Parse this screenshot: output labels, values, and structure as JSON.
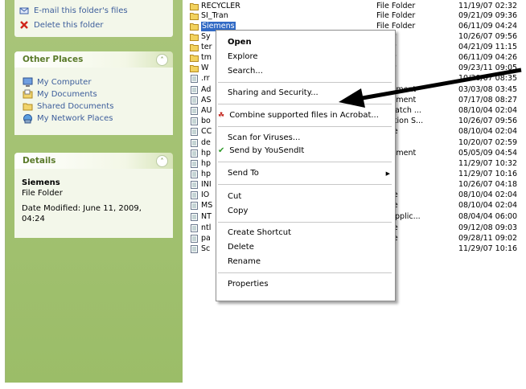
{
  "task_pane": {
    "file_tasks": [
      {
        "label": "E-mail this folder's files",
        "icon": "email-icon"
      },
      {
        "label": "Delete this folder",
        "icon": "delete-x-icon"
      }
    ],
    "other_places": {
      "title": "Other Places",
      "items": [
        {
          "label": "My Computer",
          "icon": "my-computer-icon"
        },
        {
          "label": "My Documents",
          "icon": "my-documents-icon"
        },
        {
          "label": "Shared Documents",
          "icon": "shared-documents-icon"
        },
        {
          "label": "My Network Places",
          "icon": "network-places-icon"
        }
      ]
    },
    "details": {
      "title": "Details",
      "name": "Siemens",
      "type": "File Folder",
      "date_modified": "Date Modified: June 11, 2009,",
      "time": "04:24"
    }
  },
  "files": [
    {
      "name": "RECYCLER",
      "type": "File Folder",
      "date": "11/19/07 02:32",
      "icon": "folder-icon"
    },
    {
      "name": "SI_Tran",
      "type": "File Folder",
      "date": "09/21/09 09:36",
      "icon": "folder-icon"
    },
    {
      "name": "Siemens",
      "type": "File Folder",
      "date": "06/11/09 04:24",
      "icon": "folder-icon",
      "selected": true
    },
    {
      "name": "Sy",
      "type": "older",
      "date": "10/26/07 09:56",
      "icon": "folder-icon"
    },
    {
      "name": "ter",
      "type": "older",
      "date": "04/21/09 11:15",
      "icon": "folder-icon"
    },
    {
      "name": "tm",
      "type": "older",
      "date": "06/11/09 04:26",
      "icon": "folder-icon"
    },
    {
      "name": "W",
      "type": "older",
      "date": "09/23/11 09:05",
      "icon": "folder-icon"
    },
    {
      "name": ".rr",
      "type": "",
      "date": "10/30/07 08:35",
      "icon": "file-icon"
    },
    {
      "name": "Ad",
      "type": "Document",
      "date": "03/03/08 03:45",
      "icon": "file-icon"
    },
    {
      "name": "AS",
      "type": "Document",
      "date": "07/17/08 08:27",
      "icon": "file-icon"
    },
    {
      "name": "AU",
      "type": "OS Batch ...",
      "date": "08/10/04 02:04",
      "icon": "file-icon"
    },
    {
      "name": "bo",
      "type": "guration S...",
      "date": "10/26/07 09:56",
      "icon": "file-icon"
    },
    {
      "name": "CC",
      "type": "m file",
      "date": "08/10/04 02:04",
      "icon": "file-icon"
    },
    {
      "name": "de",
      "type": "File",
      "date": "10/20/07 02:59",
      "icon": "file-icon"
    },
    {
      "name": "hp",
      "type": "Document",
      "date": "05/05/09 04:54",
      "icon": "file-icon"
    },
    {
      "name": "hp",
      "type": "File",
      "date": "11/29/07 10:32",
      "icon": "file-icon"
    },
    {
      "name": "hp",
      "type": "nage",
      "date": "11/29/07 10:16",
      "icon": "file-icon"
    },
    {
      "name": "INI",
      "type": "",
      "date": "10/26/07 04:18",
      "icon": "file-icon"
    },
    {
      "name": "IO",
      "type": "m file",
      "date": "08/10/04 02:04",
      "icon": "file-icon"
    },
    {
      "name": "MS",
      "type": "m file",
      "date": "08/10/04 02:04",
      "icon": "file-icon"
    },
    {
      "name": "NT",
      "type": "OS Applic...",
      "date": "08/04/04 06:00",
      "icon": "file-icon"
    },
    {
      "name": "ntl",
      "type": "m file",
      "date": "09/12/08 09:03",
      "icon": "file-icon"
    },
    {
      "name": "pa",
      "type": "m file",
      "date": "09/28/11 09:02",
      "icon": "file-icon"
    },
    {
      "name": "Sc",
      "type": "nage",
      "date": "11/29/07 10:16",
      "icon": "file-icon"
    }
  ],
  "context_menu": {
    "open": "Open",
    "explore": "Explore",
    "search": "Search...",
    "sharing": "Sharing and Security...",
    "combine": "Combine supported files in Acrobat...",
    "scan": "Scan for Viruses...",
    "yousendit": "Send by YouSendIt",
    "send_to": "Send To",
    "cut": "Cut",
    "copy": "Copy",
    "create_shortcut": "Create Shortcut",
    "delete": "Delete",
    "rename": "Rename",
    "properties": "Properties"
  },
  "colors": {
    "task_pane_green": "#9bbd68",
    "selection_blue": "#316ac5",
    "link_blue": "#3c5d9b",
    "arrow": "#000000"
  }
}
